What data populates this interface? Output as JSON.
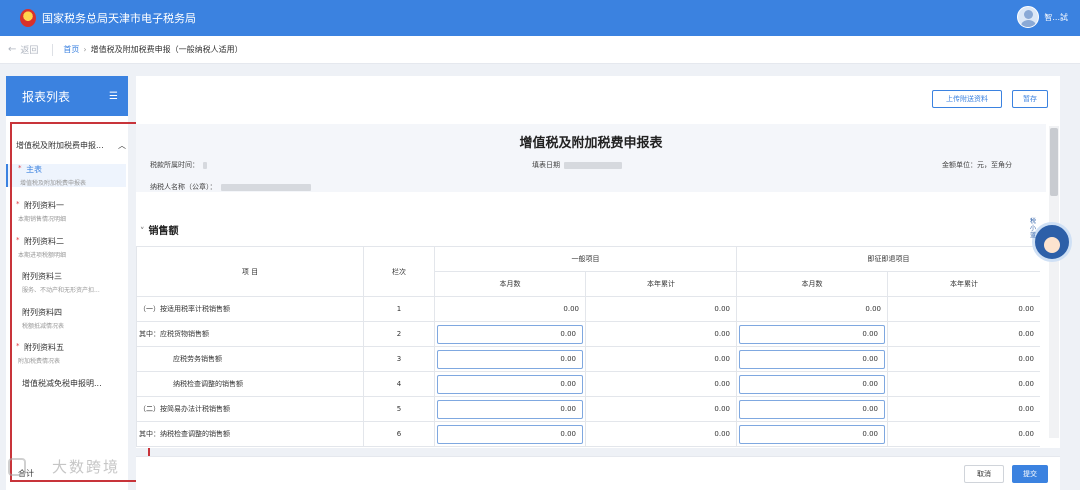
{
  "header": {
    "site_title": "国家税务总局天津市电子税务局",
    "user_name": "智...試"
  },
  "breadcrumb": {
    "back": "返回",
    "home": "首页",
    "separator": "›",
    "current": "增值税及附加税费申报（一般纳税人适用）"
  },
  "sidebar": {
    "title": "报表列表",
    "root_label": "增值税及附加税费申报...",
    "items": [
      {
        "label": "主表",
        "sub": "增值税及附加税费申报表",
        "required": "*"
      },
      {
        "label": "附列资料一",
        "sub": "本期销售情况明细",
        "required": "*"
      },
      {
        "label": "附列资料二",
        "sub": "本期进项税额明细",
        "required": "*"
      },
      {
        "label": "附列资料三",
        "sub": "服务、不动产和无形资产扣...",
        "required": ""
      },
      {
        "label": "附列资料四",
        "sub": "税额抵减情况表",
        "required": ""
      },
      {
        "label": "附列资料五",
        "sub": "附加税费情况表",
        "required": "*"
      },
      {
        "label": "增值税减免税申报明...",
        "sub": "",
        "required": ""
      }
    ],
    "bottom_text": "合计"
  },
  "toolbar": {
    "upload_label": "上传附送资料",
    "save_label": "暂存"
  },
  "form": {
    "title": "增值税及附加税费申报表",
    "period_label": "税款所属时间：",
    "fill_date_label": "填表日期",
    "unit_label": "金额单位：元，至角分",
    "taxpayer_label": "纳税人名称（公章）：",
    "section_title": "销售额"
  },
  "table": {
    "col_item": "项 目",
    "col_line": "栏次",
    "group_general": "一般项目",
    "group_refund": "即征即退项目",
    "col_month": "本月数",
    "col_year": "本年累计",
    "rows": [
      {
        "name": "（一）按适用税率计税销售额",
        "line": "1",
        "v1": "0.00",
        "v2": "0.00",
        "v3": "0.00",
        "v4": "0.00"
      },
      {
        "name": "其中：应税货物销售额",
        "line": "2",
        "v1": "0.00",
        "v2": "0.00",
        "v3": "0.00",
        "v4": "0.00"
      },
      {
        "name": "应税劳务销售额",
        "line": "3",
        "v1": "0.00",
        "v2": "0.00",
        "v3": "0.00",
        "v4": "0.00"
      },
      {
        "name": "纳税检查调整的销售额",
        "line": "4",
        "v1": "0.00",
        "v2": "0.00",
        "v3": "0.00",
        "v4": "0.00"
      },
      {
        "name": "（二）按简易办法计税销售额",
        "line": "5",
        "v1": "0.00",
        "v2": "0.00",
        "v3": "0.00",
        "v4": "0.00"
      },
      {
        "name": "其中：纳税检查调整的销售额",
        "line": "6",
        "v1": "0.00",
        "v2": "0.00",
        "v3": "0.00",
        "v4": "0.00"
      }
    ]
  },
  "mascot_label": "税小蓝",
  "footer": {
    "cancel_label": "取消",
    "submit_label": "提交"
  },
  "watermark_text": "大数跨境",
  "colors": {
    "brand_blue": "#3b82e0",
    "highlight_red": "#c8343a",
    "required_red": "#e0383e"
  }
}
